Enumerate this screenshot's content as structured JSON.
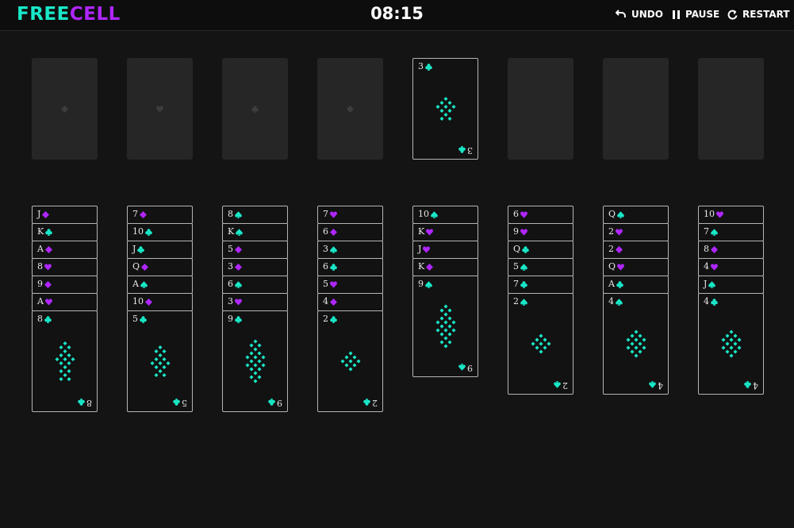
{
  "header": {
    "logo_part1": "FREE",
    "logo_part2": "CELL",
    "timer": "08:15",
    "undo_label": "UNDO",
    "pause_label": "PAUSE",
    "restart_label": "RESTART"
  },
  "colors": {
    "teal": "#19e8c8",
    "purple": "#b026ff",
    "background": "#141414"
  },
  "free_cells": [
    {
      "suit": "diamond-icon"
    },
    {
      "suit": "heart-icon"
    },
    {
      "suit": "club-icon"
    },
    {
      "suit": "diamond-icon"
    }
  ],
  "foundations": [
    {
      "rank": "3",
      "suit": "club"
    },
    {
      "rank": "",
      "suit": ""
    },
    {
      "rank": "",
      "suit": ""
    },
    {
      "rank": "",
      "suit": ""
    }
  ],
  "tableau": [
    [
      {
        "rank": "J",
        "suit": "diamond"
      },
      {
        "rank": "K",
        "suit": "club"
      },
      {
        "rank": "A",
        "suit": "diamond"
      },
      {
        "rank": "8",
        "suit": "heart"
      },
      {
        "rank": "9",
        "suit": "diamond"
      },
      {
        "rank": "A",
        "suit": "heart"
      },
      {
        "rank": "8",
        "suit": "club"
      }
    ],
    [
      {
        "rank": "7",
        "suit": "diamond"
      },
      {
        "rank": "10",
        "suit": "club"
      },
      {
        "rank": "J",
        "suit": "club"
      },
      {
        "rank": "Q",
        "suit": "diamond"
      },
      {
        "rank": "A",
        "suit": "spade"
      },
      {
        "rank": "10",
        "suit": "diamond"
      },
      {
        "rank": "5",
        "suit": "club"
      }
    ],
    [
      {
        "rank": "8",
        "suit": "spade"
      },
      {
        "rank": "K",
        "suit": "spade"
      },
      {
        "rank": "5",
        "suit": "diamond"
      },
      {
        "rank": "3",
        "suit": "diamond"
      },
      {
        "rank": "6",
        "suit": "spade"
      },
      {
        "rank": "3",
        "suit": "heart"
      },
      {
        "rank": "9",
        "suit": "club"
      }
    ],
    [
      {
        "rank": "7",
        "suit": "heart"
      },
      {
        "rank": "6",
        "suit": "diamond"
      },
      {
        "rank": "3",
        "suit": "spade"
      },
      {
        "rank": "6",
        "suit": "club"
      },
      {
        "rank": "5",
        "suit": "heart"
      },
      {
        "rank": "4",
        "suit": "diamond"
      },
      {
        "rank": "2",
        "suit": "club"
      }
    ],
    [
      {
        "rank": "10",
        "suit": "spade"
      },
      {
        "rank": "K",
        "suit": "heart"
      },
      {
        "rank": "J",
        "suit": "heart"
      },
      {
        "rank": "K",
        "suit": "diamond"
      },
      {
        "rank": "9",
        "suit": "spade"
      }
    ],
    [
      {
        "rank": "6",
        "suit": "heart"
      },
      {
        "rank": "9",
        "suit": "heart"
      },
      {
        "rank": "Q",
        "suit": "club"
      },
      {
        "rank": "5",
        "suit": "spade"
      },
      {
        "rank": "7",
        "suit": "club"
      },
      {
        "rank": "2",
        "suit": "spade"
      }
    ],
    [
      {
        "rank": "Q",
        "suit": "spade"
      },
      {
        "rank": "2",
        "suit": "heart"
      },
      {
        "rank": "2",
        "suit": "diamond"
      },
      {
        "rank": "Q",
        "suit": "heart"
      },
      {
        "rank": "A",
        "suit": "club"
      },
      {
        "rank": "4",
        "suit": "spade"
      }
    ],
    [
      {
        "rank": "10",
        "suit": "heart"
      },
      {
        "rank": "7",
        "suit": "spade"
      },
      {
        "rank": "8",
        "suit": "diamond"
      },
      {
        "rank": "4",
        "suit": "heart"
      },
      {
        "rank": "J",
        "suit": "spade"
      },
      {
        "rank": "4",
        "suit": "club"
      }
    ]
  ]
}
